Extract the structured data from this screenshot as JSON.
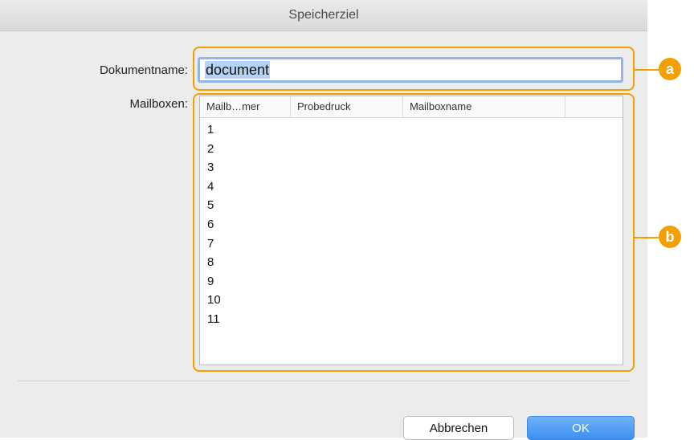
{
  "dialog": {
    "title": "Speicherziel",
    "document_name_label": "Dokumentname:",
    "document_name_value": "document",
    "mailboxes_label": "Mailboxen:"
  },
  "table": {
    "columns": [
      "Mailb…mer",
      "Probedruck",
      "Mailboxname",
      ""
    ],
    "rows": [
      "1",
      "2",
      "3",
      "4",
      "5",
      "6",
      "7",
      "8",
      "9",
      "10",
      "11"
    ]
  },
  "buttons": {
    "cancel_label": "Abbrechen",
    "ok_label": "OK"
  },
  "callouts": {
    "a": "a",
    "b": "b"
  },
  "colors": {
    "callout": "#f2a000",
    "ok_button": "#3d8ff0",
    "selection": "#b5d3f5"
  }
}
